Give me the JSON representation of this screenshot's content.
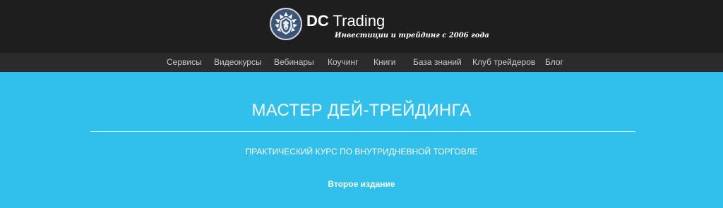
{
  "brand": {
    "name_bold": "DC",
    "name_rest": " Trading",
    "tagline": "Инвестиции и трейдинг с 2006 года",
    "logo_icon": "lion-head-icon",
    "badge_color": "#3b5478"
  },
  "nav": {
    "items": [
      {
        "label": "Сервисы"
      },
      {
        "label": "Видеокурсы"
      },
      {
        "label": "Вебинары"
      },
      {
        "label": "Коучинг"
      },
      {
        "label": "Книги"
      },
      {
        "label": "База знаний"
      },
      {
        "label": "Клуб трейдеров"
      },
      {
        "label": "Блог"
      }
    ]
  },
  "hero": {
    "title": "МАСТЕР ДЕЙ-ТРЕЙДИНГА",
    "subtitle": "ПРАКТИЧЕСКИЙ КУРС ПО ВНУТРИДНЕВНОЙ ТОРГОВЛЕ",
    "edition": "Второе издание"
  },
  "colors": {
    "header_bg": "#1e1e1e",
    "nav_bg": "#2b2b2b",
    "hero_bg": "#31bfec",
    "nav_text": "#c9c9c9"
  }
}
